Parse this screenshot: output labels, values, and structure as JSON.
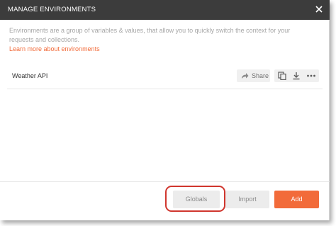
{
  "dialog": {
    "title": "MANAGE ENVIRONMENTS",
    "close_icon": "close-icon",
    "description": "Environments are a group of variables & values, that allow you to quickly switch the context for your requests and collections.",
    "learn_more": "Learn more about environments"
  },
  "environments": [
    {
      "name": "Weather API",
      "share_label": "Share",
      "icons": [
        "share-arrow-icon",
        "duplicate-icon",
        "download-icon",
        "more-icon"
      ]
    }
  ],
  "footer": {
    "globals_label": "Globals",
    "import_label": "Import",
    "add_label": "Add"
  },
  "colors": {
    "header_bg": "#3c3c3c",
    "accent": "#f26b3a",
    "highlight": "#d0362e",
    "button_bg": "#ececec"
  }
}
